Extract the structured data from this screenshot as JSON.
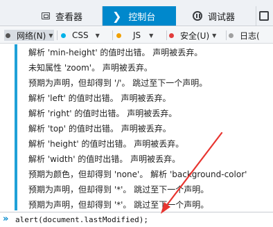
{
  "tabs": {
    "inspector": "查看器",
    "console": "控制台",
    "debugger": "调试器"
  },
  "filters": {
    "net": "网络(N)",
    "css": "CSS",
    "js": "JS",
    "security": "安全(U)",
    "log": "日志(",
    "colors": {
      "net": "#666666",
      "css": "#00b2e8",
      "js": "#f0a000",
      "security": "#e23c3c",
      "log": "#a0a0a0"
    }
  },
  "messages": [
    "解析 'min-height' 的值时出错。   声明被丢弃。",
    "未知属性 'zoom'。   声明被丢弃。",
    "预期为声明，但却得到 '/'。   跳过至下一个声明。",
    "解析 'left' 的值时出错。   声明被丢弃。",
    "解析 'right' 的值时出错。   声明被丢弃。",
    "解析 'top' 的值时出错。   声明被丢弃。",
    "解析 'height' 的值时出错。   声明被丢弃。",
    "解析 'width' 的值时出错。   声明被丢弃。",
    "预期为颜色，但却得到 'none'。   解析 'background-color'",
    "预期为声明，但却得到 '*'。   跳过至下一个声明。",
    "预期为声明，但却得到 '*'。   跳过至下一个声明。"
  ],
  "console_input": {
    "prompt": "»",
    "value": "alert(document.lastModified);"
  },
  "annotation": {
    "arrow_color": "#e8342f"
  },
  "accent": "#0088cc",
  "message_bar_color": "#1fa1d8"
}
